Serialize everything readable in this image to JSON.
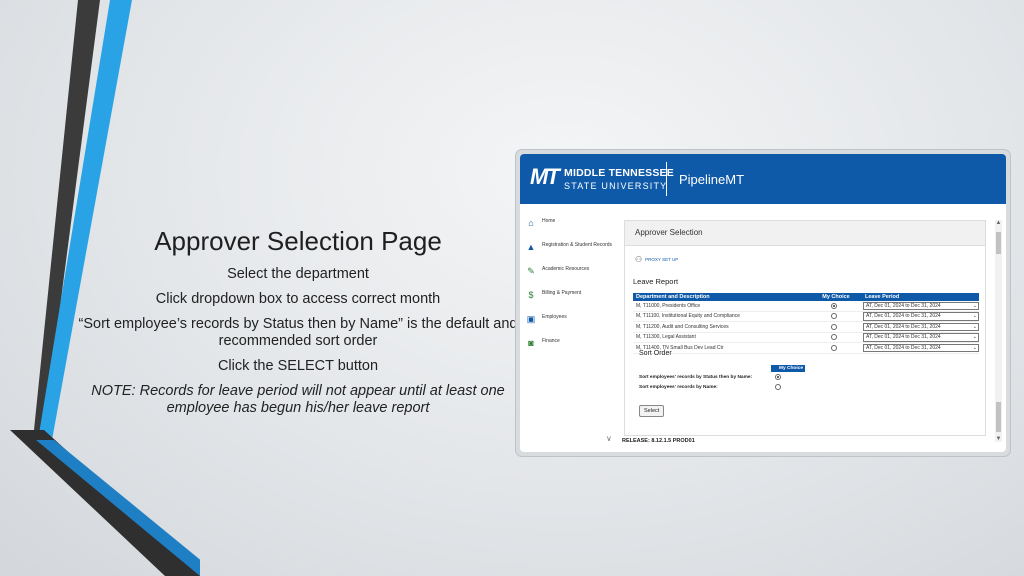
{
  "slide": {
    "title": "Approver Selection Page",
    "lines": [
      "Select the department",
      "Click dropdown box to access correct month",
      "“Sort employee’s records by Status then by Name” is the default and recommended sort order",
      "Click the SELECT button"
    ],
    "note": "NOTE: Records for leave period will not appear until at least one employee has begun his/her leave report"
  },
  "colors": {
    "brand_blue": "#0f5aa8",
    "accent_cyan": "#29a3e6",
    "dark_stripe": "#3b3b3b"
  },
  "app": {
    "logo_mark": "MT",
    "logo_line1": "MIDDLE TENNESSEE",
    "logo_line2": "STATE UNIVERSITY",
    "app_name": "PipelineMT",
    "nav": [
      {
        "label": "Home",
        "icon": "home-icon"
      },
      {
        "label": "Registration & Student Records",
        "icon": "graduation-cap-icon"
      },
      {
        "label": "Academic Resources",
        "icon": "pencil-icon"
      },
      {
        "label": "Billing & Payment",
        "icon": "dollar-icon"
      },
      {
        "label": "Employees",
        "icon": "id-card-icon"
      },
      {
        "label": "Finance",
        "icon": "money-icon"
      }
    ],
    "panel": {
      "header": "Approver Selection",
      "proxy_link": "PROXY SET UP",
      "leave_report_title": "Leave Report",
      "columns": {
        "dept": "Department and Description",
        "choice": "My Choice",
        "period": "Leave Period"
      },
      "rows": [
        {
          "dept": "M, T11000, Presidents Office",
          "checked": true,
          "period": "AT, Dec 01, 2024 to Dec 31, 2024"
        },
        {
          "dept": "M, T11100, Institutional Equity and Compliance",
          "checked": false,
          "period": "AT, Dec 01, 2024 to Dec 31, 2024"
        },
        {
          "dept": "M, T11200, Audit and Consulting Services",
          "checked": false,
          "period": "AT, Dec 01, 2024 to Dec 31, 2024"
        },
        {
          "dept": "M, T11300, Legal Assistant",
          "checked": false,
          "period": "AT, Dec 01, 2024 to Dec 31, 2024"
        },
        {
          "dept": "M, T11400, TN Small Bus Dev Lead Ctr",
          "checked": false,
          "period": "AT, Dec 01, 2024 to Dec 31, 2024"
        }
      ],
      "sort_title": "Sort Order",
      "sort_col": "My Choice",
      "sort_options": [
        {
          "label": "Sort employees' records by Status then by Name:",
          "checked": true
        },
        {
          "label": "Sort employees' records by Name:",
          "checked": false
        }
      ],
      "select_button": "Select"
    },
    "release": "RELEASE: 8.12.1.5 PROD01"
  }
}
